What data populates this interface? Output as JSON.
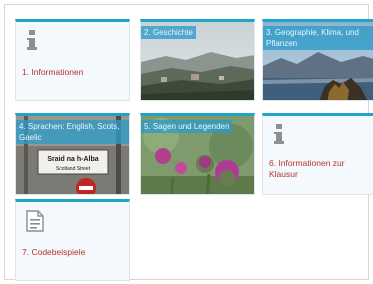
{
  "tiles": [
    {
      "label": "1. Informationen",
      "icon": "info-icon"
    },
    {
      "label": "2. Geschichte",
      "image": "landscape-photo"
    },
    {
      "label": "3. Geographie, Klima, und Pflanzen",
      "image": "mountain-lake-photo"
    },
    {
      "label": "4. Sprachen: English, Scots, Gaelic",
      "image": "street-sign-photo"
    },
    {
      "label": "5. Sagen und Legenden",
      "image": "thistle-photo"
    },
    {
      "label": "6. Informationen zur Klausur",
      "icon": "info-icon"
    },
    {
      "label": "7. Codebeispiele",
      "icon": "document-icon"
    }
  ],
  "street_sign": {
    "line1": "Sraid na h-Alba",
    "line2": "Scotland Street"
  },
  "colors": {
    "accent": "#1ea5c8",
    "label": "#b8322a",
    "tile_bg": "#f3f9fc"
  }
}
